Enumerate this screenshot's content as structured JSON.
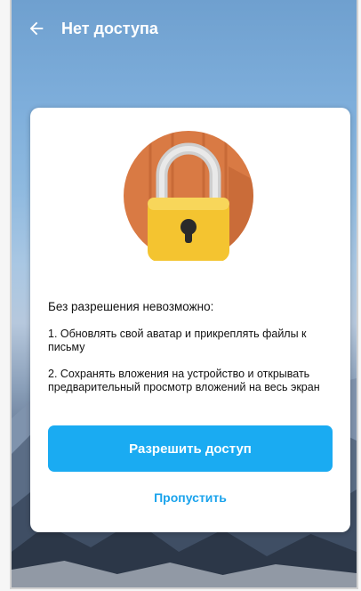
{
  "appbar": {
    "title": "Нет доступа",
    "back_icon": "arrow-left-icon"
  },
  "dialog": {
    "illustration": "padlock-icon",
    "heading": "Без разрешения невозможно:",
    "items": [
      "1. Обновлять свой аватар и прикреплять файлы к письму",
      "2. Сохранять вложения на устройство и открывать предварительный просмотр вложений на весь экран"
    ],
    "allow_button": "Разрешить доступ",
    "skip_link": "Пропустить"
  },
  "colors": {
    "accent": "#1aabf2",
    "link": "#1aa3ec",
    "lock_body": "#f4c430",
    "lock_circle": "#d97a44"
  }
}
